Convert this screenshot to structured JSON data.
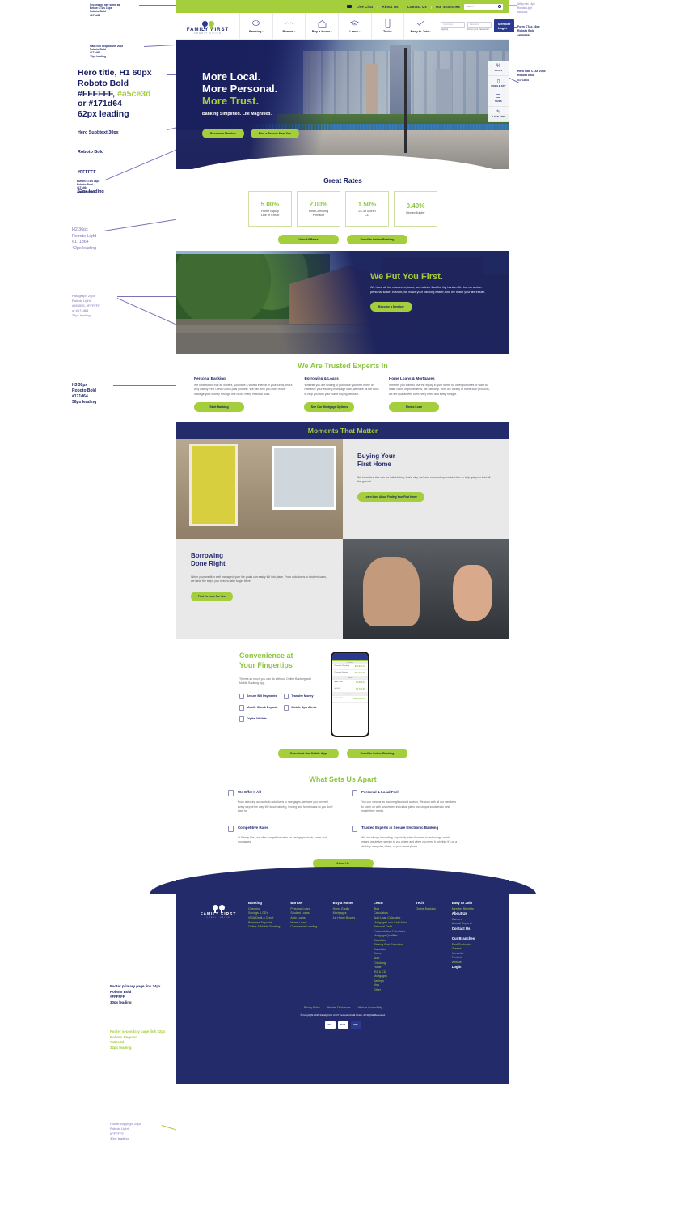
{
  "annotations": {
    "secondary_nav": "Secondary nav same as\nBelow CTAs 16px\nRoboto Bold\n#171d64",
    "main_nav_dropdowns": "Main nav dropdowns 20px\nRoboto Bold\n#171d64\n22px leading",
    "hero_title": "Hero title, H1 60px\nRoboto Bold\n#FFFFFF,",
    "hero_title_accent": "#a5ce3d",
    "hero_title_cont": "or #171d64\n62px leading",
    "hero_subtext": "Hero Subbtext 30px\n\nRoboto Bold\n\n#FFFFFF\n\n62px leading",
    "button_ctas": "Button CTAs 16px\nRoboto Bold\n#171d64\n22px leading",
    "h2": "H2 36px\nRoboto Light\n#171d64\n42px leading",
    "paragraph": "Paragraph 24px\nRoboto Light\n#555555, #FFFFFF\nor #171d64\n36px leading",
    "h3": "H3 30px\nRoboto Bold\n#171d64\n36px leading",
    "footer_primary": "Footer primary page link 24px\nRoboto Bold\n#FFFFFF\n30px leading",
    "footer_secondary": "Footer secondary page link 22px\nRoboto Regular\n#a5ce3d\n32px leading",
    "footer_copyright": "Footer copyright 20px\nRoboto Light\n#FFFFFF\n30px leading",
    "utility_nav": "Utility nav 14px\nRoboto Light\n#555555",
    "form_ctas": "Form CTAs 16px\nRoboto Bold\n#FFFFFF",
    "hero_side_ctas": "Hero side CTAs 20px\nRoboto Bold\n#171d64"
  },
  "colors": {
    "navy": "#171d64",
    "green": "#a5ce3d",
    "white": "#FFFFFF",
    "gray_text": "#555555"
  },
  "utility_nav": {
    "items": [
      "Live Chat",
      "About Us",
      "Contact Us",
      "Our Branches"
    ],
    "search_placeholder": "Search"
  },
  "brand": {
    "name": "FAMILY FIRST",
    "tagline": "CREDIT UNION"
  },
  "main_nav": {
    "items": [
      {
        "label": "Banking",
        "icon": "piggy-bank-icon"
      },
      {
        "label": "Borrow",
        "icon": "handshake-icon"
      },
      {
        "label": "Buy a Home",
        "icon": "house-icon"
      },
      {
        "label": "Learn",
        "icon": "graduation-cap-icon"
      },
      {
        "label": "Tech",
        "icon": "mobile-phone-icon"
      },
      {
        "label": "Easy to Join",
        "icon": "checkmark-icon"
      }
    ],
    "login": {
      "username_placeholder": "Username",
      "password_placeholder": "Password",
      "signup_link": "Sign Up",
      "forgot_link": "Forgot your Password?",
      "button_label": "Member Login"
    }
  },
  "hero": {
    "line1": "More Local.",
    "line2": "More Personal.",
    "line3": "More Trust.",
    "subtext": "Banking Simplified. Life Magnified.",
    "cta_primary": "Become a Member",
    "cta_secondary": "Find a Branch Near You",
    "side_tabs": [
      {
        "label": "RATES",
        "icon": "percent-icon"
      },
      {
        "label": "MOBILE APP",
        "icon": "phone-icon"
      },
      {
        "label": "NEWS",
        "icon": "news-icon"
      },
      {
        "label": "LOAN APP",
        "icon": "document-icon"
      }
    ]
  },
  "rates": {
    "title": "Great Rates",
    "cards": [
      {
        "percent": "5.00%",
        "label": "Home Equity\nLine of Credit"
      },
      {
        "percent": "2.00%",
        "label": "First Checking\nPinnacle"
      },
      {
        "percent": "1.50%",
        "label": "24-35 Month\nCD"
      },
      {
        "percent": "0.40%",
        "label": "MoneyBuilder"
      }
    ],
    "cta_primary": "View All Rates",
    "cta_secondary": "Enroll in Online Banking"
  },
  "we_put_you_first": {
    "title": "We Put You First.",
    "body": "We have all the resources, tools, and advice that the big banks offer but on a nicer personal scale. In short, we make your banking easier, and we make your life easier.",
    "cta": "Become a Member"
  },
  "trusted_experts": {
    "title": "We Are Trusted Experts In",
    "columns": [
      {
        "heading": "Personal Banking",
        "body": "We understand that as owners, you have a vested interest in your funds, that's why Family First Credit Union puts you first. We can help you more easily manage your money through one of our many financial tools.",
        "cta": "Start Banking"
      },
      {
        "heading": "Borrowing & Loans",
        "body": "Whether you are looking to purchase your first home or refinance your existing mortgage loan, we have all the tools to help you with your home buying decision.",
        "cta": "See Our Mortgage Options"
      },
      {
        "heading": "Home Loans & Mortgages",
        "body": "Whether you want to use the equity in your home for other purposes or want to make home improvements, we can help. With our variety of home loan products, we are guaranteed to fit every need and every budget.",
        "cta": "Find a Loan"
      }
    ]
  },
  "moments": {
    "title": "Moments That Matter",
    "cards": [
      {
        "heading": "Buying Your\nFirst Home",
        "body": "We know that this can be intimidating, that's why we have rounded up our best tips to help get your first off the ground.",
        "cta": "Learn More About Finding Your First Home"
      },
      {
        "heading": "Borrowing\nDone Right",
        "body": "When your credit is well managed, your life goals can easily fall into place. From auto loans to student loans, we have the steps you need to take to get there.",
        "cta": "Find the Loan For You"
      }
    ]
  },
  "convenience": {
    "title": "Convenience at\nYour Fingertips",
    "intro": "There's so much you can do with our Online Banking and Mobile Banking App.",
    "features": [
      {
        "label": "Secure Bill Payments",
        "icon": "dollar-icon"
      },
      {
        "label": "Transfer Money",
        "icon": "transfer-icon"
      },
      {
        "label": "Mobile Check Deposit",
        "icon": "check-icon"
      },
      {
        "label": "Mobile App Alerts",
        "icon": "bell-phone-icon"
      },
      {
        "label": "Digital Wallets",
        "icon": "wallet-icon"
      }
    ],
    "cta_primary": "Download Our Mobile App",
    "cta_secondary": "Enroll in Online Banking",
    "phone": {
      "header": "Accounts",
      "group1": "Checking",
      "rows": [
        {
          "name": "Personal Checking",
          "sub": "Available",
          "amount": "$13,840.19",
          "amount_sub": "Available $13,840.19"
        },
        {
          "name": "Personal Savings",
          "sub": "Available",
          "amount": "$39,340.08",
          "amount_sub": "Available $39,340.08"
        }
      ],
      "group2": "Loans",
      "rows2": [
        {
          "name": "Auto Loan",
          "sub": "Due Jan 15",
          "amount": "$1,838.47",
          "amount_sub": "Due on the 15th of the Month"
        },
        {
          "name": "HELOC",
          "sub": "Due Jan 18",
          "amount": "$8,741.03",
          "amount_sub": "Monthly"
        }
      ],
      "group3": "Overdraft",
      "rows3": [
        {
          "name": "HELOC Reserve",
          "sub": "Open",
          "amount": "$123,560.47",
          "amount_sub": ""
        }
      ]
    }
  },
  "what_sets_apart": {
    "title": "What Sets Us Apart",
    "cells": [
      {
        "heading": "We Offer It All",
        "body": "From checking accounts to auto loans to mortgages, we have you covered every step of the way. We know banking, lending and home loans so you don't have to.",
        "icon": "document-icon"
      },
      {
        "heading": "Personal & Local Feel",
        "body": "You can view us as your neighborhood advisor. We work with all our members to come up with customized individual plans and unique solutions to best match their needs.",
        "icon": "person-icon"
      },
      {
        "heading": "Competitive Rates",
        "body": "At Family First, we offer competitive rates on savings products, loans and mortgages.",
        "icon": "chart-icon"
      },
      {
        "heading": "Trusted Experts in Secure Electronic Banking",
        "body": "We are always innovating, especially when it comes to technology, which means we deliver service to you where and when you need it, whether it's on a desktop computer, tablet, or your smart phone.",
        "icon": "lock-icon"
      }
    ],
    "cta": "About Us"
  },
  "footer": {
    "brand": {
      "name": "FAMILY FIRST",
      "tagline": "CREDIT UNION"
    },
    "columns": [
      {
        "groups": [
          {
            "heading": "Banking",
            "links": [
              "Checking",
              "Savings & CD's",
              "VISA Debit & Credit",
              "Business Deposits",
              "Online & Mobile Banking"
            ]
          }
        ]
      },
      {
        "groups": [
          {
            "heading": "Borrow",
            "links": [
              "Personal Loans",
              "Student Loans",
              "Auto Loans",
              "Home Loans",
              "Commercial Lending"
            ]
          }
        ]
      },
      {
        "groups": [
          {
            "heading": "Buy a Home",
            "links": [
              "Home Equity",
              "Mortgages",
              "1st Home Buyers"
            ]
          }
        ]
      },
      {
        "groups": [
          {
            "heading": "Learn",
            "links": [
              "Blog",
              "Calculators",
              "Auto Loan Calculator",
              "Mortgage Loan Calculator",
              "Personal Debt Consolidation Calculator",
              "Mortgage Qualifier Calculator",
              "Closing Cost Estimator Calculator",
              "Rates",
              "Auto",
              "Checking",
              "Home",
              "IRA & CD",
              "Mortgages",
              "Savings",
              "Visa",
              "Other"
            ]
          }
        ]
      },
      {
        "groups": [
          {
            "heading": "Tech",
            "links": [
              "Online Banking"
            ]
          }
        ]
      },
      {
        "groups": [
          {
            "heading": "Easy to Join",
            "links": [
              "Member Benefits"
            ]
          },
          {
            "heading": "About Us",
            "links": [
              "Careers",
              "Annual Reports"
            ]
          },
          {
            "heading": "Contact Us",
            "links": []
          },
          {
            "heading": "Our Branches",
            "links": [
              "East Rochester",
              "Greece",
              "Henrietta",
              "Penfield",
              "Webster"
            ]
          },
          {
            "heading": "Login",
            "links": []
          }
        ]
      }
    ],
    "bottom_links": [
      "Privacy Policy",
      "Member Disclosures",
      "Website Accessibility"
    ],
    "copyright": "© Copyright 2019 Family First of NY Federal Credit Union. All Rights Reserved.",
    "badges": [
      "EHL",
      "NCUA",
      "VISA"
    ]
  }
}
